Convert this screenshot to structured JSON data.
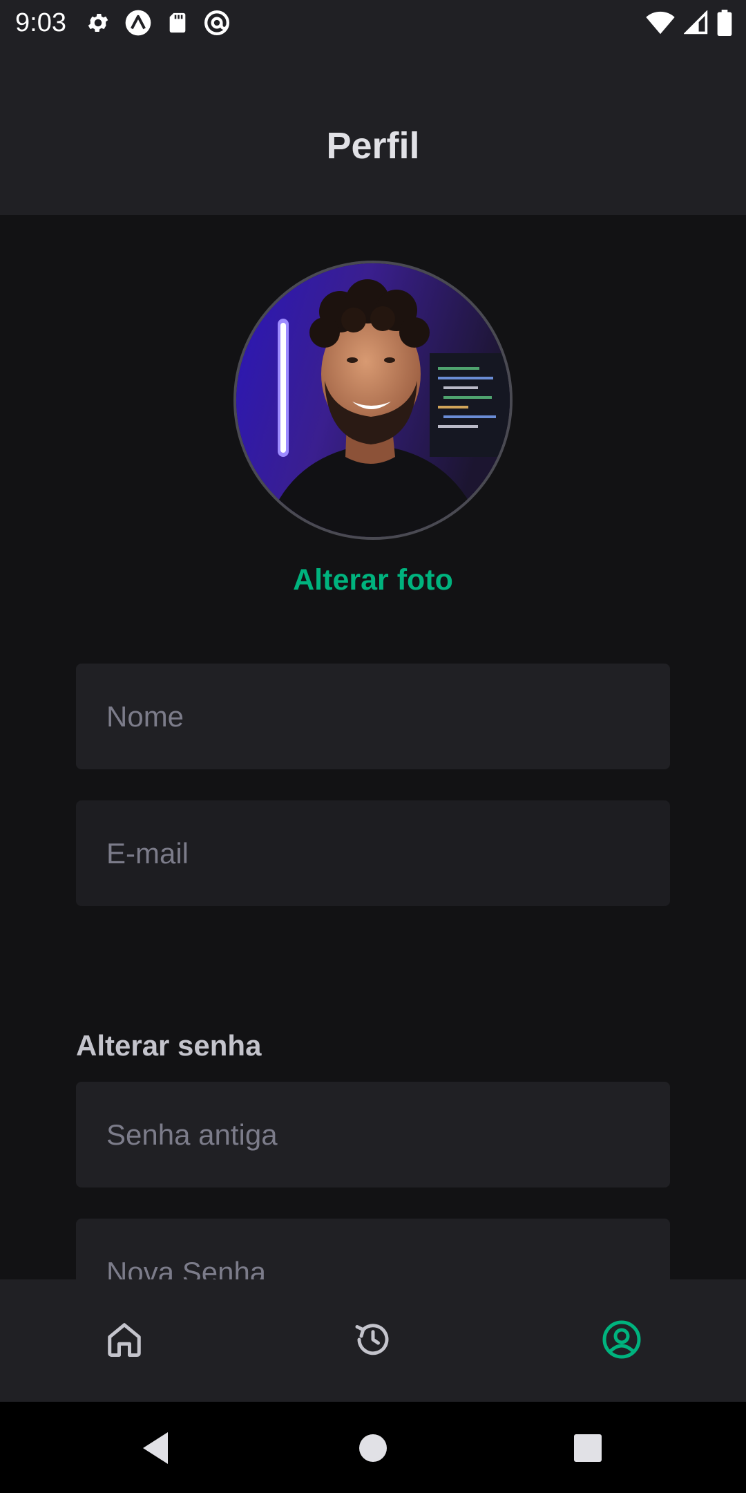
{
  "status_bar": {
    "time": "9:03",
    "left_icons": [
      "settings-gear-icon",
      "expo-icon",
      "sd-card-icon",
      "at-sign-icon"
    ],
    "right_icons": [
      "wifi-icon",
      "cell-signal-icon",
      "battery-icon"
    ]
  },
  "header": {
    "title": "Perfil"
  },
  "profile": {
    "change_photo_label": "Alterar foto"
  },
  "form": {
    "name_placeholder": "Nome",
    "email_placeholder": "E-mail",
    "change_password_title": "Alterar senha",
    "old_password_placeholder": "Senha antiga",
    "new_password_placeholder": "Nova Senha"
  },
  "tabs": [
    {
      "icon": "home-icon",
      "active": false
    },
    {
      "icon": "history-icon",
      "active": false
    },
    {
      "icon": "user-circle-icon",
      "active": true
    }
  ],
  "colors": {
    "accent": "#00b37e",
    "background": "#121214",
    "surface": "#202024",
    "title_text": "#e1e1e6",
    "placeholder_text": "#7c7c8a",
    "inactive_icon": "#c4c4cc"
  },
  "nav_bar": {
    "icons": [
      "back-triangle-icon",
      "home-circle-icon",
      "recents-square-icon"
    ]
  }
}
